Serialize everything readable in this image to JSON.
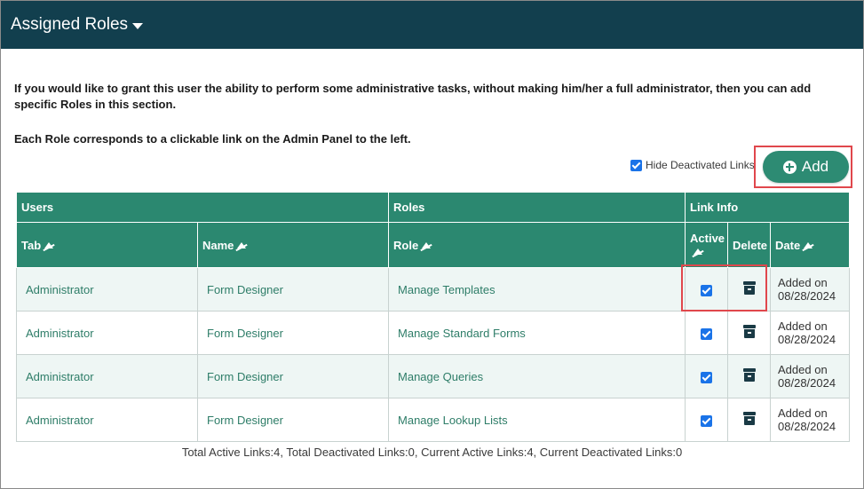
{
  "header": {
    "title": "Assigned Roles"
  },
  "description": {
    "line1": "If you would like to grant this user the ability to perform some administrative tasks, without making him/her a full administrator, then you can add specific Roles in this section.",
    "line2": "Each Role corresponds to a clickable link on the Admin Panel to the left."
  },
  "hide_deactivated": {
    "label": "Hide Deactivated Links",
    "checked": true
  },
  "add_button": {
    "label": "Add"
  },
  "table": {
    "groups": {
      "users": "Users",
      "roles": "Roles",
      "link_info": "Link Info"
    },
    "columns": {
      "tab": "Tab",
      "name": "Name",
      "role": "Role",
      "active": "Active",
      "delete": "Delete",
      "date": "Date"
    },
    "rows": [
      {
        "tab": "Administrator",
        "name": "Form Designer",
        "role": "Manage Templates",
        "active": true,
        "date_label": "Added on",
        "date": "08/28/2024"
      },
      {
        "tab": "Administrator",
        "name": "Form Designer",
        "role": "Manage Standard Forms",
        "active": true,
        "date_label": "Added on",
        "date": "08/28/2024"
      },
      {
        "tab": "Administrator",
        "name": "Form Designer",
        "role": "Manage Queries",
        "active": true,
        "date_label": "Added on",
        "date": "08/28/2024"
      },
      {
        "tab": "Administrator",
        "name": "Form Designer",
        "role": "Manage Lookup Lists",
        "active": true,
        "date_label": "Added on",
        "date": "08/28/2024"
      }
    ]
  },
  "footer": {
    "summary": "Total Active Links:4, Total Deactivated Links:0, Current Active Links:4, Current Deactivated Links:0"
  },
  "colors": {
    "header_bg": "#123f4e",
    "accent": "#2b8870",
    "highlight": "#e0474c"
  },
  "icons": {
    "add": "plus-circle-icon",
    "delete": "archive-icon",
    "sort": "sort-icon",
    "dropdown": "caret-down-icon"
  }
}
